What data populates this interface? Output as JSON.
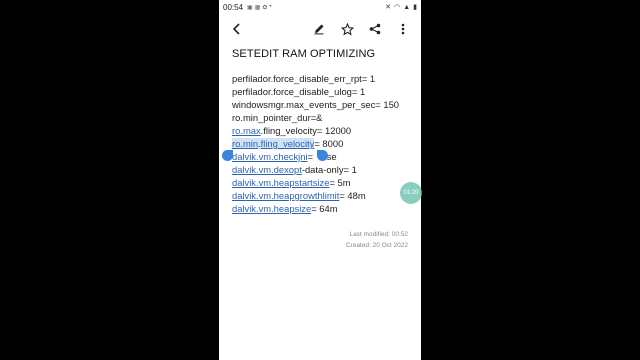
{
  "status_bar": {
    "time": "00:54"
  },
  "note": {
    "title": "SETEDIT RAM OPTIMIZING",
    "lines": [
      "perfilador.force_disable_err_rpt= 1",
      "perfilador.force_disable_ulog= 1",
      "windowsmgr.max_events_per_sec= 150",
      "ro.min_pointer_dur=&"
    ],
    "line5": {
      "link": "ro.max",
      "rest": ".fling_velocity= 12000"
    },
    "line6": {
      "link1": "ro.min",
      "mid": ".",
      "link2": "fling_velocity",
      "rest": "= 8000"
    },
    "line7": {
      "link": "dalvik.vm.checkjni",
      "rest": "= ",
      "tail": "lse"
    },
    "line8": {
      "link": "dalvik.vm.dexopt",
      "rest": "-data-only= 1"
    },
    "line9": {
      "link": "dalvik.vm.heapstartsize",
      "rest": "= 5m"
    },
    "line10": {
      "link": "dalvik.vm.heapgrowthlimit",
      "rest": "= 48m"
    },
    "line11": {
      "link": "dalvik.vm.heapsize",
      "rest": "= 64m"
    },
    "last_modified": "Last modified: 00:52",
    "created": "Created: 20 Oct 2022"
  },
  "floating_button": {
    "label": "01:20"
  },
  "icons": {
    "back": "back-arrow-icon",
    "edit": "pencil-icon",
    "favorite": "star-icon",
    "share": "share-icon",
    "more": "more-vert-icon"
  },
  "colors": {
    "link": "#2d63b3",
    "selection": "#cfe2f7",
    "handle": "#3b84e0",
    "floating": "#5fbeaa"
  }
}
